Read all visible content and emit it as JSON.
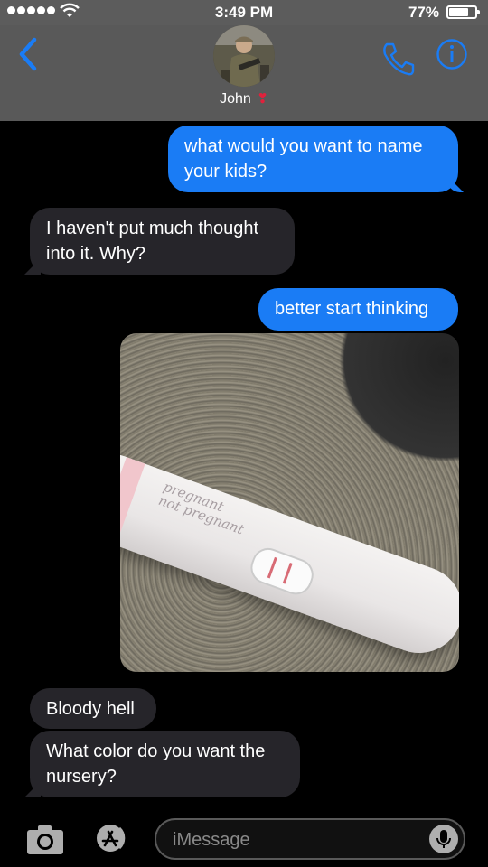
{
  "status_bar": {
    "time": "3:49 PM",
    "battery_percent": "77%",
    "battery_level": 0.77,
    "signal_bars": 5,
    "icons": [
      "signal-dots",
      "wifi-icon",
      "battery-icon"
    ]
  },
  "header": {
    "contact_name": "John",
    "contact_emoji": "❣",
    "icons": [
      "back-chevron-icon",
      "avatar",
      "phone-icon",
      "info-icon"
    ]
  },
  "messages": [
    {
      "direction": "outgoing",
      "text": "what would you want to name your kids?"
    },
    {
      "direction": "incoming",
      "text": "I haven't put much thought into it. Why?"
    },
    {
      "direction": "outgoing",
      "text": "better start thinking"
    },
    {
      "direction": "outgoing",
      "type": "photo",
      "photo_text": [
        "pregnant",
        "not pregnant"
      ]
    },
    {
      "direction": "incoming",
      "text": "Bloody hell"
    },
    {
      "direction": "incoming",
      "text": "What color do you want the nursery?"
    }
  ],
  "input_bar": {
    "placeholder": "iMessage",
    "icons": [
      "camera-icon",
      "app-store-icon",
      "microphone-icon"
    ]
  },
  "colors": {
    "outgoing_bubble": "#1a7cf5",
    "incoming_bubble": "#26252a",
    "accent": "#1a7cf5"
  }
}
